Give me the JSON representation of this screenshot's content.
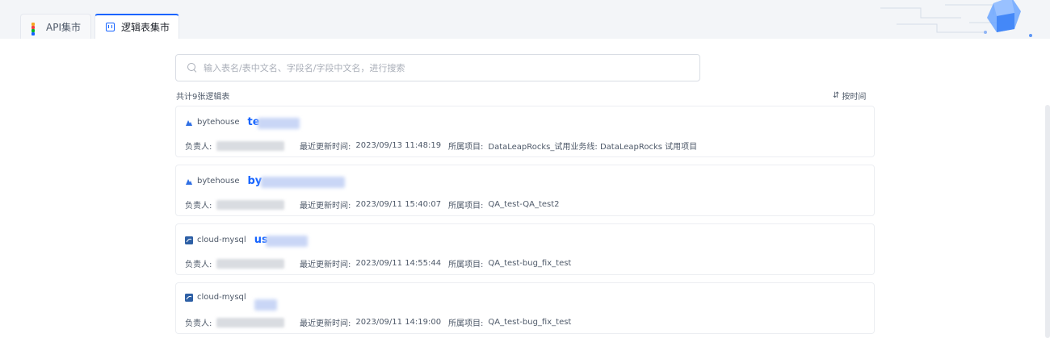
{
  "tabs": [
    {
      "label": "API集市",
      "icon": "grid-icon",
      "active": false
    },
    {
      "label": "逻辑表集市",
      "icon": "table-icon",
      "active": true
    }
  ],
  "search": {
    "placeholder": "输入表名/表中文名、字段名/字段中文名，进行搜索"
  },
  "summary": {
    "count_text": "共计9张逻辑表",
    "sort_label": "按时间",
    "sort_icon": "sort-icon"
  },
  "meta_labels": {
    "owner": "负责人:",
    "updated": "最近更新时间:",
    "project": "所属项目:"
  },
  "colors": {
    "accent": "#1664ff",
    "bytehouse": "#2f6fe4",
    "mysql": "#2d5fa5"
  },
  "cards": [
    {
      "source": "bytehouse",
      "source_icon": "bytehouse-icon",
      "name": "te",
      "updated": "2023/09/13 11:48:19",
      "project": "DataLeapRocks_试用业务线: DataLeapRocks 试用项目"
    },
    {
      "source": "bytehouse",
      "source_icon": "bytehouse-icon",
      "name": "by",
      "updated": "2023/09/11 15:40:07",
      "project": "QA_test-QA_test2"
    },
    {
      "source": "cloud-mysql",
      "source_icon": "mysql-icon",
      "name": "us",
      "updated": "2023/09/11 14:55:44",
      "project": "QA_test-bug_fix_test"
    },
    {
      "source": "cloud-mysql",
      "source_icon": "mysql-icon",
      "name": "",
      "updated": "2023/09/11 14:19:00",
      "project": "QA_test-bug_fix_test"
    }
  ]
}
